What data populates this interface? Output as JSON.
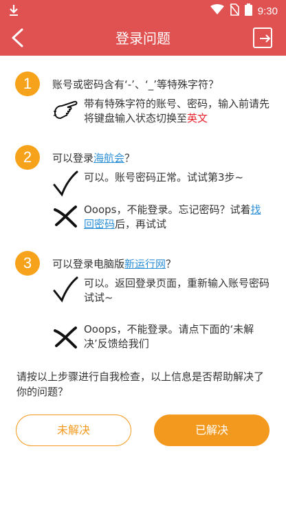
{
  "status_bar": {
    "time": "9:30",
    "icons": [
      "download-icon",
      "wifi-icon",
      "no-sim-icon",
      "battery-icon"
    ]
  },
  "header": {
    "title": "登录问题",
    "back_icon": "back-arrow-icon",
    "share_icon": "share-icon"
  },
  "step1": {
    "number": "1",
    "question": "账号或密码含有‘-’、‘_’等特殊字符？",
    "hint_icon": "pointing-hand-icon",
    "answer_text": "带有特殊字符的账号、密码，输入前请先将键盘输入状态切换至",
    "answer_highlight": "英文"
  },
  "step2": {
    "number": "2",
    "question_prefix": "可以登录",
    "question_link": "海航会",
    "question_suffix": "？",
    "yes_answer": "可以。账号密码正常。试试第3步~",
    "no_answer_prefix": "Ooops，不能登录。忘记密码？试着",
    "no_answer_link": "找回密码",
    "no_answer_suffix": "后，再试试"
  },
  "step3": {
    "number": "3",
    "question_prefix": "可以登录电脑版",
    "question_link": "新运行网",
    "question_suffix": "？",
    "yes_answer": "可以。返回登录页面，重新输入账号密码试试~",
    "no_answer": "Ooops，不能登录。请点下面的‘未解决’反馈给我们"
  },
  "footer": {
    "question": "请按以上步骤进行自我检查，以上信息是否帮助解决了你的问题？"
  },
  "buttons": {
    "unsolved": "未解决",
    "solved": "已解决"
  },
  "colors": {
    "header_bg": "#e05252",
    "accent_orange": "#f39a1e",
    "link_blue": "#2b8fd8",
    "highlight_red": "#e8202a"
  }
}
